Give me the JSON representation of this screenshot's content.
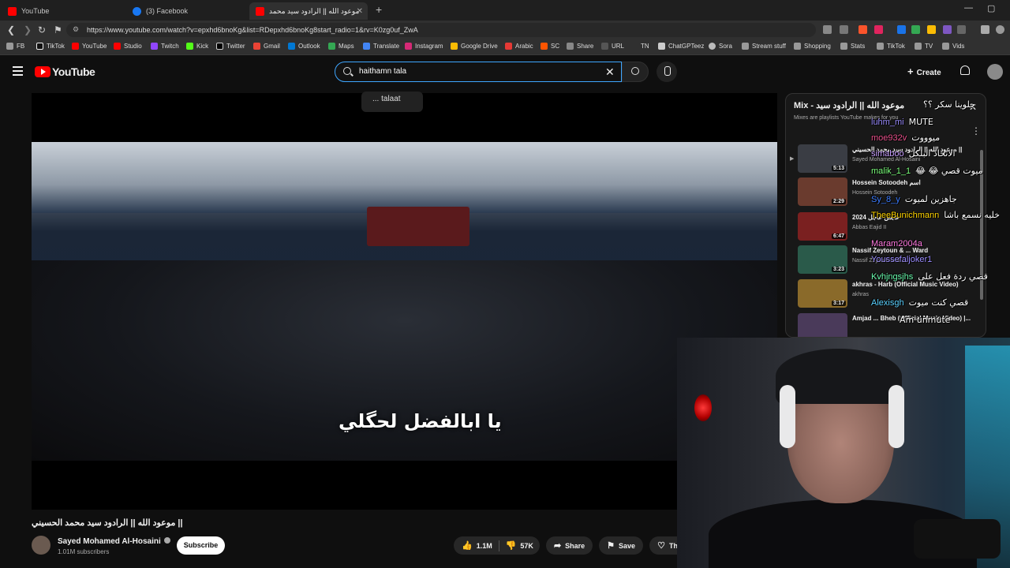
{
  "browser": {
    "tabs": [
      {
        "label": "YouTube",
        "color": "#ff0000"
      },
      {
        "label": "(3) Facebook",
        "color": "#1877f2"
      },
      {
        "label": "موعود الله || الرادود سيد محمد",
        "color": "#ff0000"
      }
    ],
    "url": "https://www.youtube.com/watch?v=epxhd6bnoKg&list=RDepxhd6bnoKg8start_radio=1&rv=K0zg0uf_ZwA",
    "bookmarks": [
      {
        "label": "FB",
        "icon": "folder-icon"
      },
      {
        "label": "TikTok",
        "icon": "tiktok-icon"
      },
      {
        "label": "YouTube",
        "icon": "youtube-icon"
      },
      {
        "label": "Studio",
        "icon": "studio-icon"
      },
      {
        "label": "Twitch",
        "icon": "twitch-icon"
      },
      {
        "label": "Kick",
        "icon": "kick-icon"
      },
      {
        "label": "Twitter",
        "icon": "x-icon"
      },
      {
        "label": "Gmail",
        "icon": "gmail-icon"
      },
      {
        "label": "Outlook",
        "icon": "outlook-icon"
      },
      {
        "label": "Maps",
        "icon": "maps-icon"
      },
      {
        "label": "Translate",
        "icon": "translate-icon"
      },
      {
        "label": "Instagram",
        "icon": "instagram-icon"
      },
      {
        "label": "Google Drive",
        "icon": "drive-icon"
      },
      {
        "label": "Arabic",
        "icon": "arabic-icon"
      },
      {
        "label": "SC",
        "icon": "sc-icon"
      },
      {
        "label": "Share",
        "icon": "share-icon"
      },
      {
        "label": "URL",
        "icon": "url-icon"
      },
      {
        "label": "TN",
        "icon": "tn-icon"
      },
      {
        "label": "ChatGPTeez",
        "icon": "chatgpt-icon"
      },
      {
        "label": "Sora",
        "icon": "sora-icon"
      },
      {
        "label": "Stream stuff",
        "icon": "folder-icon"
      },
      {
        "label": "Shopping",
        "icon": "folder-icon"
      },
      {
        "label": "Stats",
        "icon": "folder-icon"
      },
      {
        "label": "TikTok",
        "icon": "folder-icon"
      },
      {
        "label": "TV",
        "icon": "folder-icon"
      },
      {
        "label": "Vids",
        "icon": "folder-icon"
      }
    ]
  },
  "youtube": {
    "logo_text": "YouTube",
    "search_value": "haithamn tala",
    "suggestion": "... talaat",
    "create_label": "Create",
    "video": {
      "subtitle": "يا ابالفضل لحگلي",
      "title": "موعود الله || الرادود سيد محمد الحسيني ||",
      "channel": "Sayed Mohamed Al-Hosaini",
      "subscribers": "1.01M subscribers",
      "subscribe_label": "Subscribe",
      "likes": "1.1M",
      "dislikes": "57K",
      "share_label": "Share",
      "save_label": "Save",
      "thanks_label": "Than"
    },
    "playlist": {
      "title": "Mix - موعود الله || الرادود سيد",
      "subtitle": "Mixes are playlists YouTube makes for you",
      "items": [
        {
          "title": "موعود الله || الرادود سيد محمد الحسيني ||",
          "channel": "Sayed Mohamed Al-Hosaini",
          "duration": "5:13",
          "color": "#3a3d44"
        },
        {
          "title": "Hossein Sotoodeh اسم",
          "channel": "Hossein Sotoodeh",
          "duration": "2:29",
          "color": "#6a3b2e"
        },
        {
          "title": "2024 عابس عاجل",
          "channel": "Abbas Eajid II",
          "duration": "6:47",
          "color": "#7a2020"
        },
        {
          "title": "Nassif Zeytoun & ... Ward",
          "channel": "Nassif Zeytoun and ...",
          "duration": "3:23",
          "color": "#2a5a4a"
        },
        {
          "title": "akhras - Harb (Official Music Video)",
          "channel": "akhras",
          "duration": "3:17",
          "color": "#8a6a2a"
        },
        {
          "title": "Amjad ... Bheb (Official Music Video) |...",
          "channel": "",
          "duration": "",
          "color": "#4a3a5a"
        }
      ]
    }
  },
  "chat": [
    {
      "user": "",
      "text": "حلوينا سكر ؟؟",
      "color": "#ffffff"
    },
    {
      "user": "luhm_mi",
      "text": "MUTE",
      "color": "#9b8cff"
    },
    {
      "user": "moe932v",
      "text": "ميوووت",
      "color": "#e9508b"
    },
    {
      "user": "simaboo",
      "text": "الانحاد البلكل",
      "color": "#c9a0ff"
    },
    {
      "user": "malik_1_1",
      "text": "😂 😂 ميوت قصي",
      "color": "#7cff7c"
    },
    {
      "user": "Sy_8_y",
      "text": "جاهزين لميوت",
      "color": "#3a7bff"
    },
    {
      "user": "TheeBunichmann",
      "text": "خليه نسمع باشا",
      "color": "#ffd400"
    },
    {
      "user": "Maram2004a",
      "text": "",
      "color": "#ff7ae0"
    },
    {
      "user": "Youssefaljoker1",
      "text": "",
      "color": "#9b8cff"
    },
    {
      "user": "Kvhjngsjhs",
      "text": "قصي ردة فعل على",
      "color": "#6bffb0"
    },
    {
      "user": "Alexisgh",
      "text": "قصي كنت ميوت",
      "color": "#5ad1ff"
    },
    {
      "user": "",
      "text": "Am unmute",
      "color": "#ffffff"
    }
  ],
  "colors": {
    "accent_red": "#ff0000",
    "search_focus": "#3ea6ff",
    "background": "#0f0f0f"
  }
}
